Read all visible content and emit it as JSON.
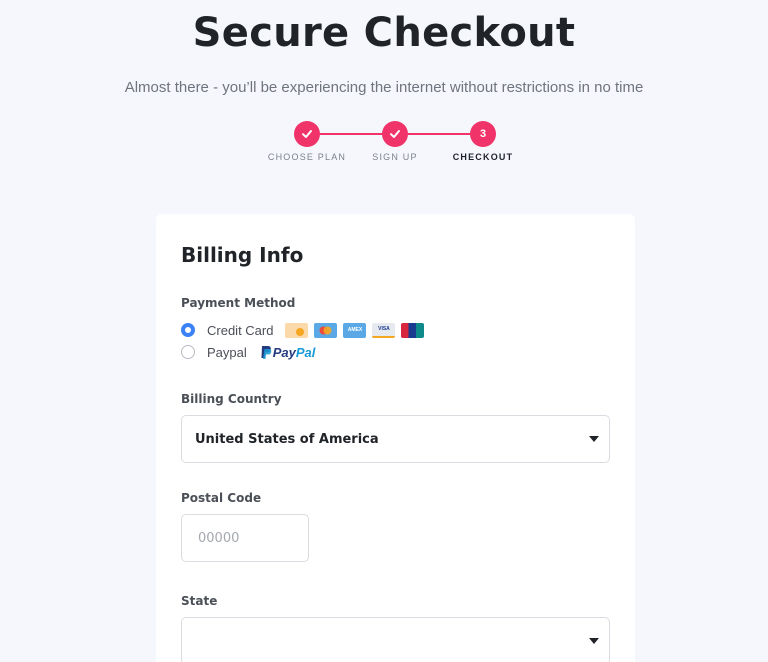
{
  "header": {
    "title": "Secure Checkout",
    "subtitle": "Almost there - you’ll be experiencing the internet without restrictions in no time"
  },
  "stepper": {
    "steps": [
      {
        "label": "CHOOSE PLAN",
        "state": "done",
        "marker": "check"
      },
      {
        "label": "SIGN UP",
        "state": "done",
        "marker": "check"
      },
      {
        "label": "CHECKOUT",
        "state": "active",
        "marker": "3"
      }
    ],
    "accent": "#f0346a"
  },
  "billing": {
    "title": "Billing Info",
    "payment_method_label": "Payment Method",
    "methods": [
      {
        "label": "Credit Card",
        "selected": true,
        "icons": [
          "generic-card-icon",
          "mastercard-icon",
          "amex-icon",
          "visa-icon",
          "unionpay-icon"
        ]
      },
      {
        "label": "Paypal",
        "selected": false,
        "icons": [
          "paypal-logo"
        ]
      }
    ],
    "paypal_logo_text": {
      "part1": "Pay",
      "part2": "Pal"
    },
    "card_icon_text": {
      "amex": "AMEX",
      "visa": "VISA"
    },
    "country_label": "Billing Country",
    "country_value": "United States of America",
    "postal_label": "Postal Code",
    "postal_placeholder": "00000",
    "state_label": "State",
    "state_value": ""
  },
  "colors": {
    "background": "#f5f7fd",
    "card": "#ffffff",
    "radio_selected": "#3c82f6"
  }
}
